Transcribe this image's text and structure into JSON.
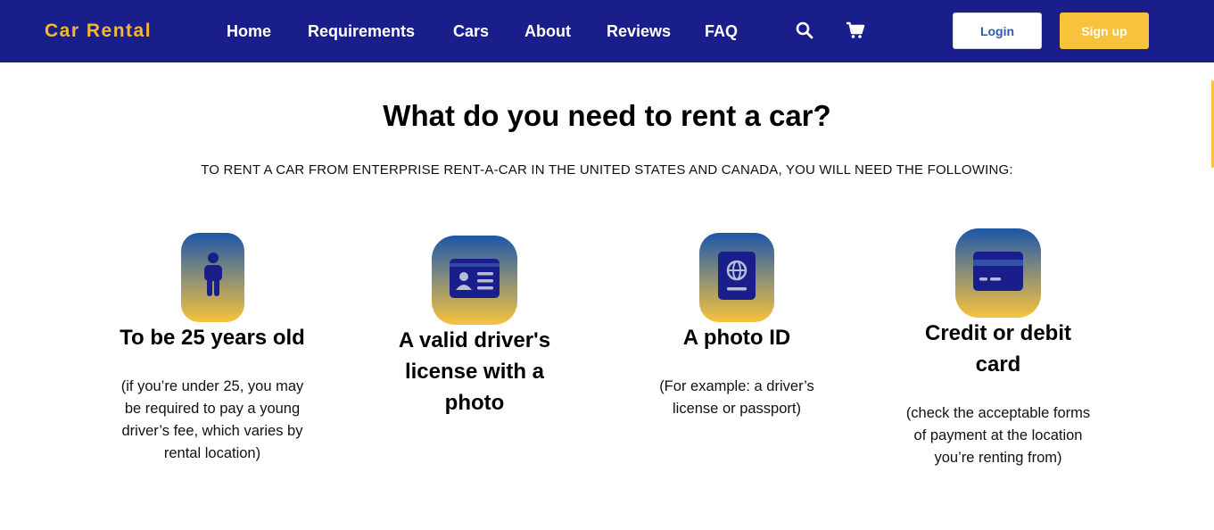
{
  "brand": "Car Rental",
  "nav": {
    "links": [
      "Home",
      "Requirements",
      "Cars",
      "About",
      "Reviews",
      "FAQ"
    ],
    "login_label": "Login",
    "signup_label": "Sign up"
  },
  "icons": {
    "search": "search-icon",
    "cart": "cart-icon",
    "person": "person-icon",
    "id_card": "id-card-icon",
    "passport": "passport-icon",
    "credit_card": "credit-card-icon"
  },
  "colors": {
    "navbar": "#1a1e8a",
    "brand": "#f8b731",
    "accent": "#f8c23c",
    "icon_gradient_top": "#1c56a8",
    "icon_gradient_bottom": "#f8c23c"
  },
  "main": {
    "title": "What do you need to rent a car?",
    "subtitle": "TO RENT A CAR FROM ENTERPRISE RENT-A-CAR IN THE UNITED STATES AND CANADA, YOU WILL NEED THE FOLLOWING:",
    "requirements": [
      {
        "title": "To be 25 years old",
        "desc_lines": [
          "(if you’re under 25, you may",
          "be required to pay a young",
          "driver’s fee, which varies by",
          "rental location)"
        ]
      },
      {
        "title_lines": [
          "A valid driver's",
          "license with a",
          "photo"
        ]
      },
      {
        "title": "A photo ID",
        "desc_lines": [
          "(For example: a driver’s",
          "license or passport)"
        ]
      },
      {
        "title_lines": [
          "Credit or debit",
          "card"
        ],
        "desc_lines": [
          "(check the acceptable forms",
          "of payment at the location",
          "you’re renting from)"
        ]
      }
    ]
  }
}
